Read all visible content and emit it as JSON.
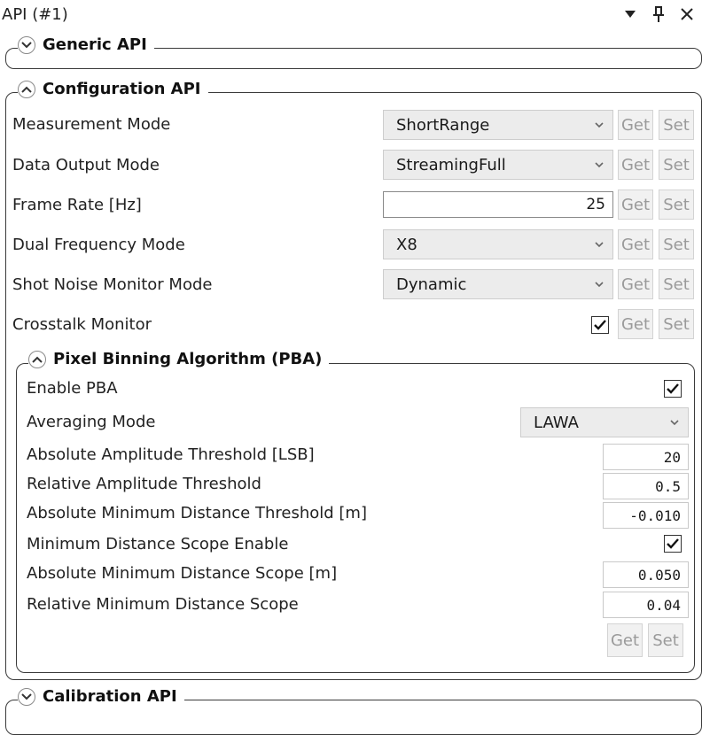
{
  "window": {
    "title": "API (#1)"
  },
  "generic_api": {
    "title": "Generic API"
  },
  "configuration_api": {
    "title": "Configuration API",
    "get_label": "Get",
    "set_label": "Set",
    "measurement_mode": {
      "label": "Measurement Mode",
      "value": "ShortRange"
    },
    "data_output_mode": {
      "label": "Data Output Mode",
      "value": "StreamingFull"
    },
    "frame_rate": {
      "label": "Frame Rate [Hz]",
      "value": "25"
    },
    "dual_frequency_mode": {
      "label": "Dual Frequency Mode",
      "value": "X8"
    },
    "shot_noise_monitor_mode": {
      "label": "Shot Noise Monitor Mode",
      "value": "Dynamic"
    },
    "crosstalk_monitor": {
      "label": "Crosstalk Monitor",
      "checked": true
    }
  },
  "pba": {
    "title": "Pixel Binning Algorithm (PBA)",
    "enable_pba": {
      "label": "Enable PBA",
      "checked": true
    },
    "averaging_mode": {
      "label": "Averaging Mode",
      "value": "LAWA"
    },
    "abs_amp_threshold": {
      "label": "Absolute Amplitude Threshold [LSB]",
      "value": "20"
    },
    "rel_amp_threshold": {
      "label": "Relative Amplitude Threshold",
      "value": "0.5"
    },
    "abs_min_dist_threshold": {
      "label": "Absolute Minimum Distance Threshold [m]",
      "value": "-0.010"
    },
    "min_dist_scope_enable": {
      "label": "Minimum Distance Scope Enable",
      "checked": true
    },
    "abs_min_dist_scope": {
      "label": "Absolute Minimum Distance Scope [m]",
      "value": "0.050"
    },
    "rel_min_dist_scope": {
      "label": "Relative Minimum Distance Scope",
      "value": "0.04"
    },
    "get_label": "Get",
    "set_label": "Set"
  },
  "calibration_api": {
    "title": "Calibration API"
  },
  "icons": {
    "dropdown": "chevron-down-icon",
    "pin": "pin-icon",
    "close": "close-icon",
    "expand": "expand-icon",
    "collapse": "collapse-icon",
    "check": "checkmark-icon"
  }
}
